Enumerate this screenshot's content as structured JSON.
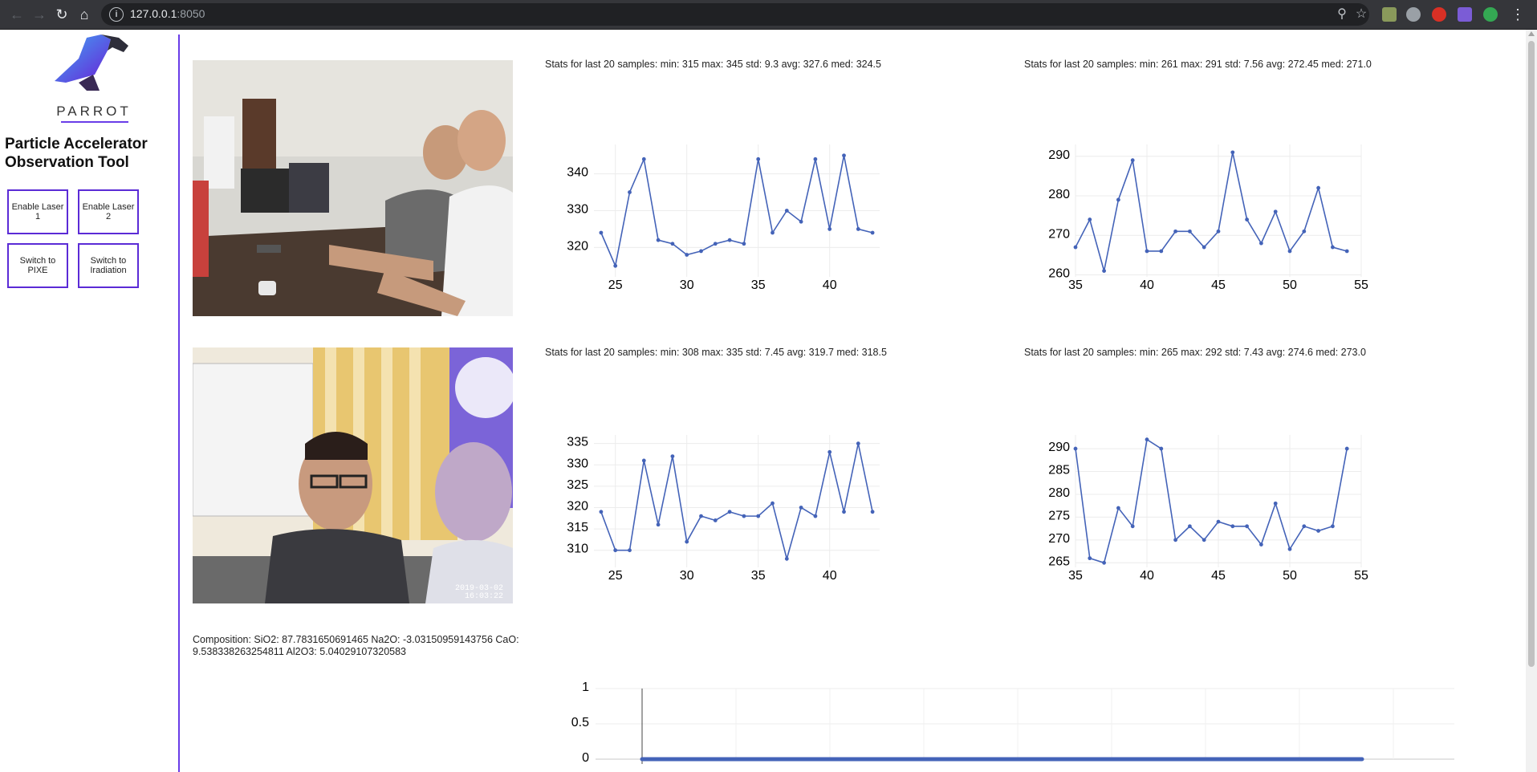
{
  "browser": {
    "url_host": "127.0.0.1",
    "url_port": ":8050"
  },
  "sidebar": {
    "logo_text": "PARROT",
    "app_title": "Particle Accelerator Observation Tool",
    "buttons": [
      {
        "label": "Enable Laser 1"
      },
      {
        "label": "Enable Laser 2"
      },
      {
        "label": "Switch to PIXE"
      },
      {
        "label": "Switch to Iradiation"
      }
    ]
  },
  "camera2": {
    "timestamp": "2019-03-02 16:03:22"
  },
  "charts": [
    {
      "stats": "Stats for last 20 samples: min: 315 max: 345 std: 9.3 avg: 327.6 med: 324.5",
      "chart_data": {
        "type": "line",
        "x": [
          24,
          25,
          26,
          27,
          28,
          29,
          30,
          31,
          32,
          33,
          34,
          35,
          36,
          37,
          38,
          39,
          40,
          41,
          42,
          43
        ],
        "y": [
          324,
          315,
          335,
          344,
          322,
          321,
          318,
          319,
          321,
          322,
          321,
          344,
          324,
          330,
          327,
          344,
          325,
          345,
          325,
          324
        ],
        "xlim": [
          23.5,
          43.5
        ],
        "ylim": [
          312,
          348
        ],
        "xticks": [
          25,
          30,
          35,
          40
        ],
        "yticks": [
          320,
          330,
          340
        ]
      }
    },
    {
      "stats": "Stats for last 20 samples: min: 261 max: 291 std: 7.56 avg: 272.45 med: 271.0",
      "chart_data": {
        "type": "line",
        "x": [
          35,
          36,
          37,
          38,
          39,
          40,
          41,
          42,
          43,
          44,
          45,
          46,
          47,
          48,
          49,
          50,
          51,
          52,
          53,
          54
        ],
        "y": [
          267,
          274,
          261,
          279,
          289,
          266,
          266,
          271,
          271,
          267,
          271,
          291,
          274,
          268,
          276,
          266,
          271,
          282,
          267,
          266
        ],
        "xlim": [
          35,
          55
        ],
        "ylim": [
          259.5,
          293
        ],
        "xticks": [
          35,
          40,
          45,
          50,
          55
        ],
        "yticks": [
          260,
          270,
          280,
          290
        ]
      }
    },
    {
      "stats": "Stats for last 20 samples: min: 308 max: 335 std: 7.45 avg: 319.7 med: 318.5",
      "chart_data": {
        "type": "line",
        "x": [
          24,
          25,
          26,
          27,
          28,
          29,
          30,
          31,
          32,
          33,
          34,
          35,
          36,
          37,
          38,
          39,
          40,
          41,
          42,
          43
        ],
        "y": [
          319,
          310,
          310,
          331,
          316,
          332,
          312,
          318,
          317,
          319,
          318,
          318,
          321,
          308,
          320,
          318,
          333,
          319,
          335,
          319
        ],
        "xlim": [
          23.5,
          43.5
        ],
        "ylim": [
          306,
          337
        ],
        "xticks": [
          25,
          30,
          35,
          40
        ],
        "yticks": [
          310,
          315,
          320,
          325,
          330,
          335
        ]
      }
    },
    {
      "stats": "Stats for last 20 samples: min: 265 max: 292 std: 7.43 avg: 274.6 med: 273.0",
      "chart_data": {
        "type": "line",
        "x": [
          35,
          36,
          37,
          38,
          39,
          40,
          41,
          42,
          43,
          44,
          45,
          46,
          47,
          48,
          49,
          50,
          51,
          52,
          53,
          54
        ],
        "y": [
          290,
          266,
          265,
          277,
          273,
          292,
          290,
          270,
          273,
          270,
          274,
          273,
          273,
          269,
          278,
          268,
          273,
          272,
          273,
          290
        ],
        "xlim": [
          35,
          55
        ],
        "ylim": [
          264,
          293
        ],
        "xticks": [
          35,
          40,
          45,
          50,
          55
        ],
        "yticks": [
          265,
          270,
          275,
          280,
          285,
          290
        ]
      }
    }
  ],
  "composition": "Composition: SiO2: 87.7831650691465 Na2O: -3.03150959143756 CaO: 9.538338263254811 Al2O3: 5.04029107320583",
  "bottom_chart": {
    "chart_data": {
      "type": "line",
      "yticks": [
        "1",
        "0.5",
        "0"
      ],
      "ylim": [
        0,
        1
      ],
      "series_value": 0
    }
  },
  "colors": {
    "accent": "#6a3de8",
    "line": "#4463b8"
  }
}
